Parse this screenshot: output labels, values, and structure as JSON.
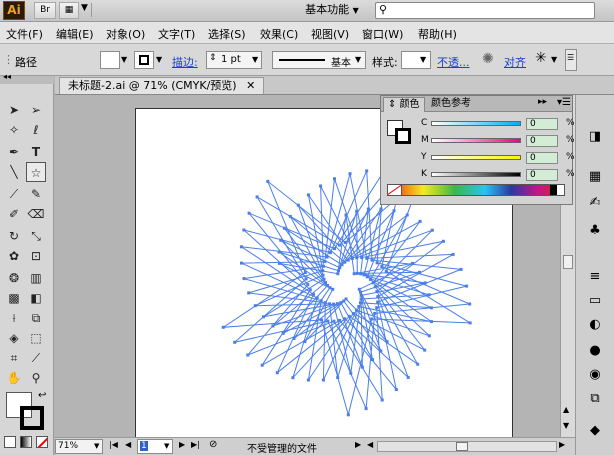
{
  "app": {
    "logo": "Ai",
    "bridge_btn": "Br",
    "workspace": "基本功能"
  },
  "menu": [
    "文件(F)",
    "编辑(E)",
    "对象(O)",
    "文字(T)",
    "选择(S)",
    "效果(C)",
    "视图(V)",
    "窗口(W)",
    "帮助(H)"
  ],
  "control": {
    "selection_type": "路径",
    "stroke_link": "描边:",
    "stroke_weight": "1 pt",
    "brush_label": "基本",
    "style_label": "样式:",
    "opacity_link": "不透...",
    "align_link": "对齐"
  },
  "document": {
    "tab_title": "未标题-2.ai @ 71% (CMYK/预览)"
  },
  "color_panel": {
    "tab_color": "颜色",
    "tab_guide": "颜色参考",
    "channels": [
      {
        "label": "C",
        "value": "0",
        "unit": "%",
        "color": "#00aeef"
      },
      {
        "label": "M",
        "value": "0",
        "unit": "%",
        "color": "#ec008c"
      },
      {
        "label": "Y",
        "value": "0",
        "unit": "%",
        "color": "#fff200"
      },
      {
        "label": "K",
        "value": "0",
        "unit": "%",
        "color": "#000000"
      }
    ]
  },
  "status": {
    "zoom": "71%",
    "page": "1",
    "message": "不受管理的文件"
  },
  "colors": {
    "artwork_stroke": "#4a7ee8",
    "artboard": "#ffffff"
  }
}
